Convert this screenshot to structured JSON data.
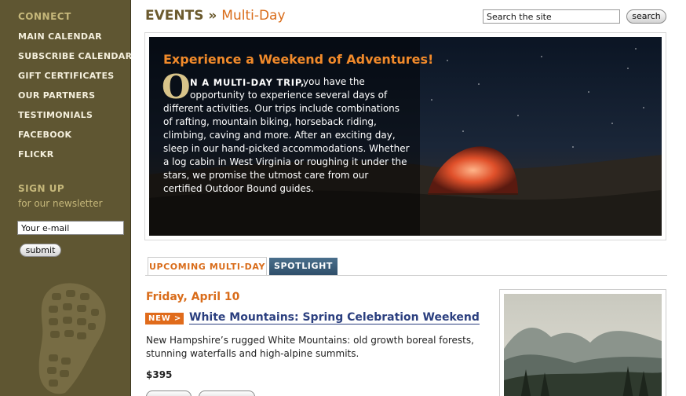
{
  "sidebar": {
    "connect_heading": "CONNECT",
    "nav": [
      {
        "label": "MAIN CALENDAR"
      },
      {
        "label": "SUBSCRIBE CALENDAR"
      },
      {
        "label": "GIFT CERTIFICATES"
      },
      {
        "label": "OUR PARTNERS"
      },
      {
        "label": "TESTIMONIALS"
      },
      {
        "label": "FACEBOOK"
      },
      {
        "label": "FLICKR"
      }
    ],
    "signup_heading": "SIGN UP",
    "signup_sub": "for our newsletter",
    "email_value": "Your e-mail",
    "submit_label": "submit"
  },
  "header": {
    "section": "EVENTS",
    "separator": "»",
    "subsection": "Multi-Day",
    "search_value": "Search the site",
    "search_label": "search"
  },
  "hero": {
    "heading": "Experience a Weekend of Adventures!",
    "dropcap": "O",
    "lead": "N A MULTI-DAY TRIP,",
    "line1_rest": "you have the",
    "lines": [
      "opportunity to experience several days of",
      "different activities. Our trips include combinations",
      "of rafting, mountain biking, horseback riding,",
      "climbing, caving and more. After an exciting day,",
      "sleep in our hand-picked accommodations. Whether",
      "a log cabin in West Virginia or roughing it under the",
      "stars, we promise the utmost care from our",
      "certified Outdoor Bound guides."
    ]
  },
  "tabs": {
    "upcoming": "UPCOMING MULTI-DAY",
    "spotlight": "SPOTLIGHT"
  },
  "event": {
    "date": "Friday, April 10",
    "badge": "NEW >",
    "title": "White Mountains: Spring Celebration Weekend",
    "desc_lines": [
      "New Hampshire’s rugged White Mountains: old growth boreal forests,",
      "stunning waterfalls and high-alpine summits."
    ],
    "price": "$395"
  },
  "colors": {
    "sidebar_bg": "#5f5632",
    "accent_orange": "#d96c1a",
    "title_brown": "#6b5a2e",
    "link_blue": "#2b3f7f",
    "tab_blue": "#3a5d7a"
  },
  "icons": {
    "boot_print": "boot-print-icon"
  }
}
